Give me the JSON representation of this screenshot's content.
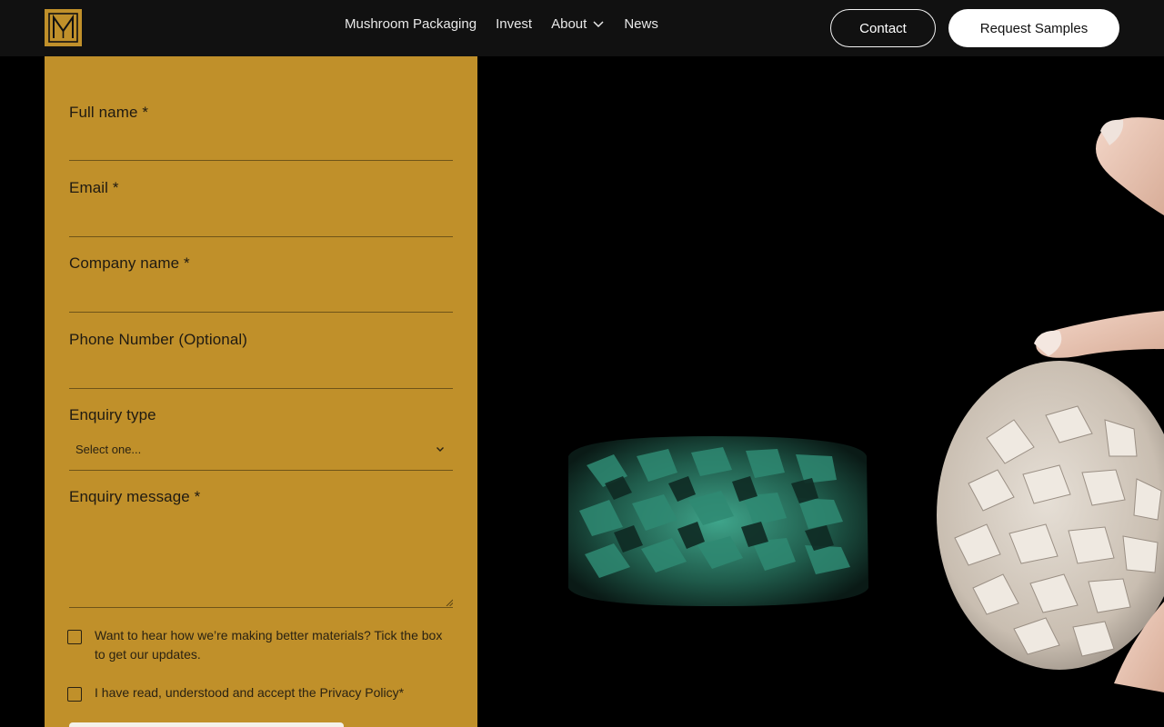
{
  "nav": {
    "logo_alt": "M",
    "links": [
      "Mushroom Packaging",
      "Invest",
      "About",
      "News"
    ],
    "contact_label": "Contact",
    "samples_label": "Request Samples"
  },
  "form": {
    "full_name_label": "Full name *",
    "email_label": "Email *",
    "company_label": "Company name *",
    "phone_label": "Phone Number (Optional)",
    "enquiry_type_label": "Enquiry type",
    "enquiry_type_value": "Select one...",
    "enquiry_message_label": "Enquiry message *",
    "updates_checkbox_label": "Want to hear how we’re making better materials? Tick the box to get our updates.",
    "privacy_checkbox_label": "I have read, understood and accept the Privacy Policy*"
  },
  "colors": {
    "panel": "#c0902a",
    "nav": "#111111",
    "background": "#000000",
    "teal_material": "#2a7f6b",
    "white_material": "#d9d2c9"
  }
}
